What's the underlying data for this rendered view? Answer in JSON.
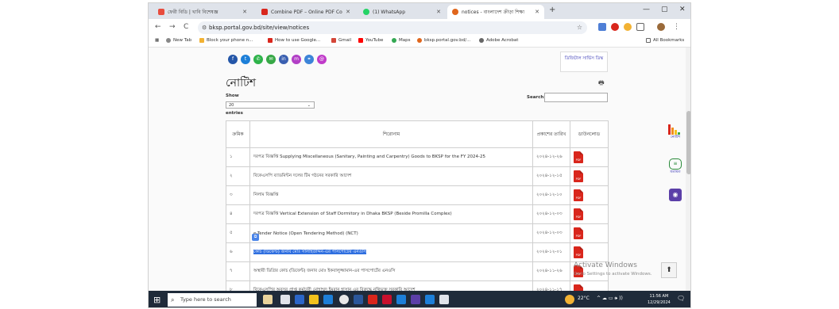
{
  "browser": {
    "tabs": [
      {
        "label": "ফেরী বিডি | খাবি বিশেষজ্ঞ",
        "color": "#e84c3d"
      },
      {
        "label": "Combine PDF – Online PDF Co",
        "color": "#d9261c"
      },
      {
        "label": "(1) WhatsApp",
        "color": "#25d366"
      },
      {
        "label": "notices - বাংলাদেশ ক্রীড়া শিক্ষা",
        "color": "#e0661c"
      }
    ],
    "new_tab": "+",
    "win_minimize": "—",
    "win_maximize": "▢",
    "win_close": "✕",
    "back": "←",
    "forward": "→",
    "reload": "C",
    "url": "bksp.portal.gov.bd/site/view/notices",
    "bookmarks": [
      "New Tab",
      "Block your phone n...",
      "How to use Google...",
      "Gmail",
      "YouTube",
      "Maps",
      "bksp.portal.gov.bd/...",
      "Adobe Acrobat"
    ],
    "all_bookmarks": "All Bookmarks"
  },
  "page": {
    "side_box": "ডিজিটাল সার্ভিস ডিস্ক",
    "title": "নোটিশ",
    "show_label": "Show",
    "show_value": "20",
    "entries_label": "entries",
    "search_label": "Search:",
    "headers": [
      "ক্রমিক",
      "শিরোনাম",
      "প্রকাশের তারিখ",
      "ডাউনলোড"
    ],
    "rows": [
      {
        "num": "১",
        "title": "দরপত্র বিজ্ঞপ্তি Supplying Miscellaneous (Sanitary, Painting and Carpentry) Goods to BKSP for the FY 2024-25",
        "date": "২০২৪-১২-২৬"
      },
      {
        "num": "২",
        "title": "বিকেএসপি ব্যাডমিন্টন দলের টিম গঠনের সরকারি আদেশ",
        "date": "২০২৪-১২-১৫"
      },
      {
        "num": "৩",
        "title": "নিলাম বিজ্ঞপ্তি",
        "date": "২০২৪-১২-১০"
      },
      {
        "num": "৪",
        "title": "দরপত্র বিজ্ঞপ্তি Vertical Extension of Staff Dormitory in Dhaka BKSP (Beside Promilla Complex)",
        "date": "২০২৪-১২-০৩"
      },
      {
        "num": "৫",
        "title": "e-Tender Notice (Open Tendering Method) (NCT)",
        "date": "২০২৪-১২-০৩"
      },
      {
        "num": "৬",
        "title": "কোচ (ডিফেন্ট) জনাব মোঃ সালাহউদ্দিন-এর পাসপোর্টের এনওসি",
        "date": "২০২৪-১২-০১"
      },
      {
        "num": "৭",
        "title": "অস্থায়ী ডিগ্রির কোচ (ডিফেন্ট) জনাব মোঃ ইকবালুজ্জামান-এর পাসপোর্টের এনওসি",
        "date": "২০২৪-১১-২৬"
      },
      {
        "num": "৮",
        "title": "বিকেএসপির অবসর প্রাপ্ত কর্মচারী মোহাম্মদ ইমরান হাসান এর বিরুদ্ধে নথিভুক্ত সরকারি আদেশ",
        "date": "২০২৪-১১-১৭"
      }
    ],
    "pdf_label": "PDF",
    "right_widgets": [
      "নোটিশ",
      "মতামত"
    ],
    "watermark_title": "Activate Windows",
    "watermark_sub": "Go to Settings to activate Windows.",
    "scroll_top": "⬆"
  },
  "taskbar": {
    "search_placeholder": "Type here to search",
    "weather": "22°C",
    "time": "11:56 AM",
    "date": "12/29/2024"
  },
  "colors": {
    "pdf": "#d9261c",
    "highlight": "#2f6fe0",
    "taskbar": "#1f2b3a"
  }
}
